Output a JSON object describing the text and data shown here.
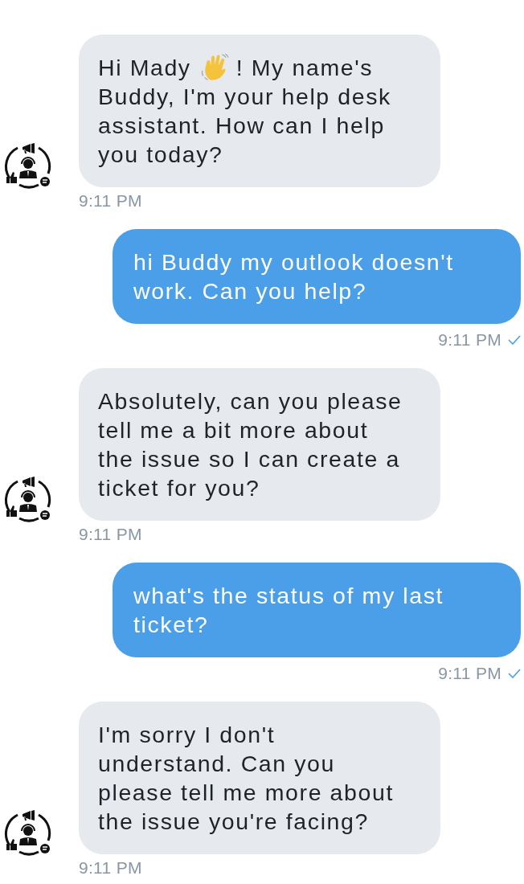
{
  "messages": [
    {
      "kind": "bot",
      "lines": [
        [
          {
            "kind": "text",
            "text": "Hi Mady"
          },
          {
            "kind": "emoji"
          },
          {
            "kind": "text",
            "text": "! My name's"
          }
        ],
        [
          {
            "kind": "text",
            "text": "Buddy, I'm your help desk"
          }
        ],
        [
          {
            "kind": "text",
            "text": "assistant. How can I help"
          }
        ],
        [
          {
            "kind": "text",
            "text": "you today?"
          }
        ]
      ],
      "time": "9:11 PM",
      "read": false
    },
    {
      "kind": "user",
      "lines": [
        [
          {
            "kind": "text",
            "text": "hi Buddy my outlook doesn't"
          }
        ],
        [
          {
            "kind": "text",
            "text": "work. Can you help?"
          }
        ]
      ],
      "time": "9:11 PM",
      "read": true
    },
    {
      "kind": "bot",
      "lines": [
        [
          {
            "kind": "text",
            "text": "Absolutely, can you please"
          }
        ],
        [
          {
            "kind": "text",
            "text": "tell me a bit more about"
          }
        ],
        [
          {
            "kind": "text",
            "text": "the issue so I can create a"
          }
        ],
        [
          {
            "kind": "text",
            "text": "ticket for you?"
          }
        ]
      ],
      "time": "9:11 PM",
      "read": false
    },
    {
      "kind": "user",
      "lines": [
        [
          {
            "kind": "text",
            "text": "what's the status of my last"
          }
        ],
        [
          {
            "kind": "text",
            "text": "ticket?"
          }
        ]
      ],
      "time": "9:11 PM",
      "read": true
    },
    {
      "kind": "bot",
      "lines": [
        [
          {
            "kind": "text",
            "text": "I'm sorry I don't"
          }
        ],
        [
          {
            "kind": "text",
            "text": "understand. Can you"
          }
        ],
        [
          {
            "kind": "text",
            "text": "please tell me more about"
          }
        ],
        [
          {
            "kind": "text",
            "text": "the issue you're facing?"
          }
        ]
      ],
      "time": "9:11 PM",
      "read": false
    }
  ]
}
